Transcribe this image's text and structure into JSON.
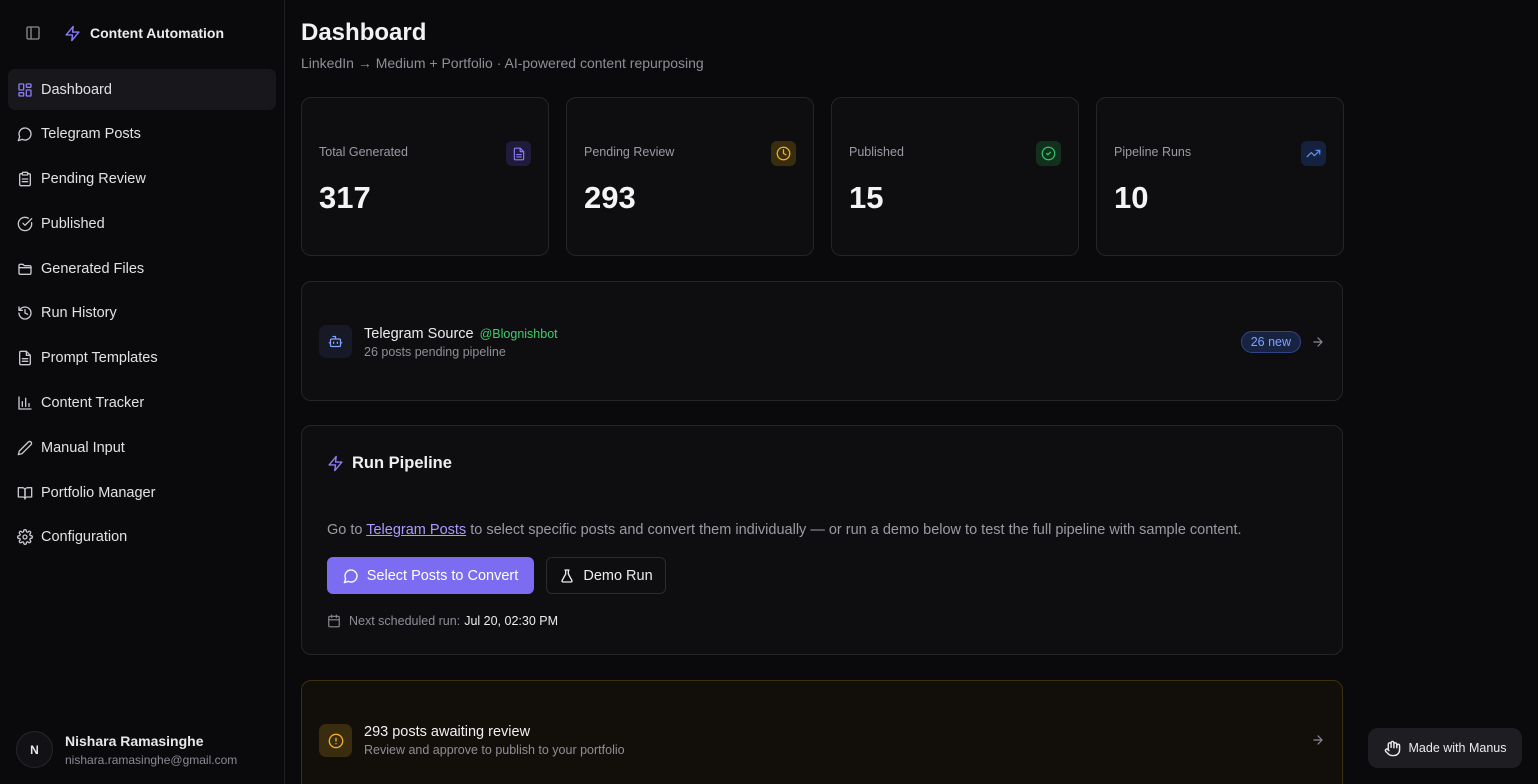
{
  "brand": {
    "title": "Content Automation"
  },
  "sidebar": {
    "items": [
      {
        "label": "Dashboard",
        "icon": "grid-icon",
        "active": true
      },
      {
        "label": "Telegram Posts",
        "icon": "message-icon"
      },
      {
        "label": "Pending Review",
        "icon": "clipboard-icon"
      },
      {
        "label": "Published",
        "icon": "check-circle-icon"
      },
      {
        "label": "Generated Files",
        "icon": "folder-icon"
      },
      {
        "label": "Run History",
        "icon": "history-icon"
      },
      {
        "label": "Prompt Templates",
        "icon": "file-text-icon"
      },
      {
        "label": "Content Tracker",
        "icon": "bar-chart-icon"
      },
      {
        "label": "Manual Input",
        "icon": "pen-icon"
      },
      {
        "label": "Portfolio Manager",
        "icon": "book-icon"
      },
      {
        "label": "Configuration",
        "icon": "gear-icon"
      }
    ],
    "user": {
      "initial": "N",
      "name": "Nishara Ramasinghe",
      "email": "nishara.ramasinghe@gmail.com"
    }
  },
  "header": {
    "title": "Dashboard",
    "subtitle": "LinkedIn → Medium + Portfolio · AI-powered content repurposing"
  },
  "stats": [
    {
      "label": "Total Generated",
      "value": "317",
      "icon": "file-icon",
      "color": "#8b7cf6"
    },
    {
      "label": "Pending Review",
      "value": "293",
      "icon": "clock-icon",
      "color": "#f0b429"
    },
    {
      "label": "Published",
      "value": "15",
      "icon": "check-circle-icon",
      "color": "#34c26a"
    },
    {
      "label": "Pipeline Runs",
      "value": "10",
      "icon": "trending-up-icon",
      "color": "#5b8def"
    }
  ],
  "telegram": {
    "title": "Telegram Source",
    "handle": "@Blognishbot",
    "subtitle": "26 posts pending pipeline",
    "badge": "26 new"
  },
  "pipeline": {
    "title": "Run Pipeline",
    "desc_before": "Go to ",
    "desc_link": "Telegram Posts",
    "desc_after": " to select specific posts and convert them individually — or run a demo below to test the full pipeline with sample content.",
    "primary_label": "Select Posts to Convert",
    "secondary_label": "Demo Run",
    "schedule_label": "Next scheduled run:",
    "schedule_value": "Jul 20, 02:30 PM"
  },
  "review": {
    "title": "293 posts awaiting review",
    "subtitle": "Review and approve to publish to your portfolio"
  },
  "footer": {
    "manus_label": "Made with Manus"
  },
  "colors": {
    "accent": "#7c6cf2",
    "bg": "#0a0a0c",
    "card": "#0e0e11"
  }
}
